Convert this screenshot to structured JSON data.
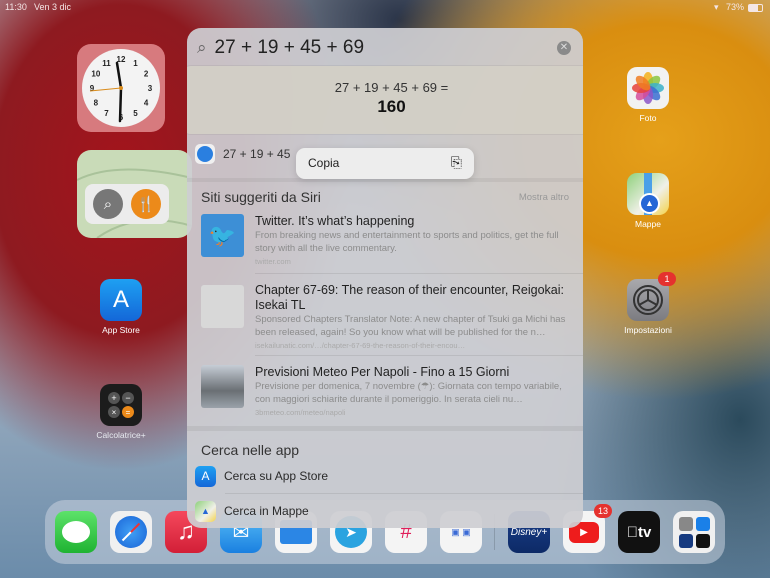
{
  "status_bar": {
    "time": "11:30",
    "date": "Ven 3 dic",
    "battery": "73%"
  },
  "home": {
    "apps_left": [
      {
        "name": "App Store"
      },
      {
        "name": "Calcolatrice+"
      }
    ],
    "apps_right": [
      {
        "name": "Foto"
      },
      {
        "name": "Mappe"
      },
      {
        "name": "Impostazioni",
        "badge": "1"
      }
    ],
    "clock_numbers": [
      "12",
      "1",
      "2",
      "3",
      "4",
      "5",
      "6",
      "7",
      "8",
      "9",
      "10",
      "11"
    ]
  },
  "dock": {
    "apps": [
      "Messaggi",
      "Safari",
      "Musica",
      "Mail",
      "File",
      "Telegram",
      "Slack",
      "Altro",
      "Disney+",
      "YouTube",
      "Apple TV",
      "Libreria app"
    ],
    "youtube_badge": "13",
    "disney_label": "Disney+",
    "tv_label": "tv"
  },
  "spotlight": {
    "query": "27 + 19 + 45 + 69",
    "calculator": {
      "expression": "27 + 19 + 45 + 69 =",
      "result": "160"
    },
    "safari_row": "27 + 19 + 45",
    "context_menu": {
      "copy_label": "Copia"
    },
    "siri_section": {
      "title": "Siti suggeriti da Siri",
      "show_more": "Mostra altro"
    },
    "results": [
      {
        "title": "Twitter. It’s what’s happening",
        "description": "From breaking news and entertainment to sports and politics, get the full story with all the live commentary.",
        "url": "twitter.com"
      },
      {
        "title": "Chapter 67-69: The reason of their encounter, Reigokai: Isekai TL",
        "description": "Sponsored Chapters Translator Note: A new chapter of Tsuki ga Michi has been released, again! So you know what will be published for the n…",
        "url": "isekailunatic.com/…/chapter-67-69-the-reason-of-their-encou…"
      },
      {
        "title": "Previsioni Meteo Per Napoli - Fino a 15 Giorni",
        "description": "Previsione per domenica, 7 novembre (☂): Giornata con tempo variabile, con maggiori schiarite durante il pomeriggio. In serata cieli nu…",
        "url": "3bmeteo.com/meteo/napoli"
      }
    ],
    "apps_section": {
      "title": "Cerca nelle app",
      "items": [
        {
          "label": "Cerca su App Store"
        },
        {
          "label": "Cerca in Mappe"
        }
      ]
    }
  }
}
